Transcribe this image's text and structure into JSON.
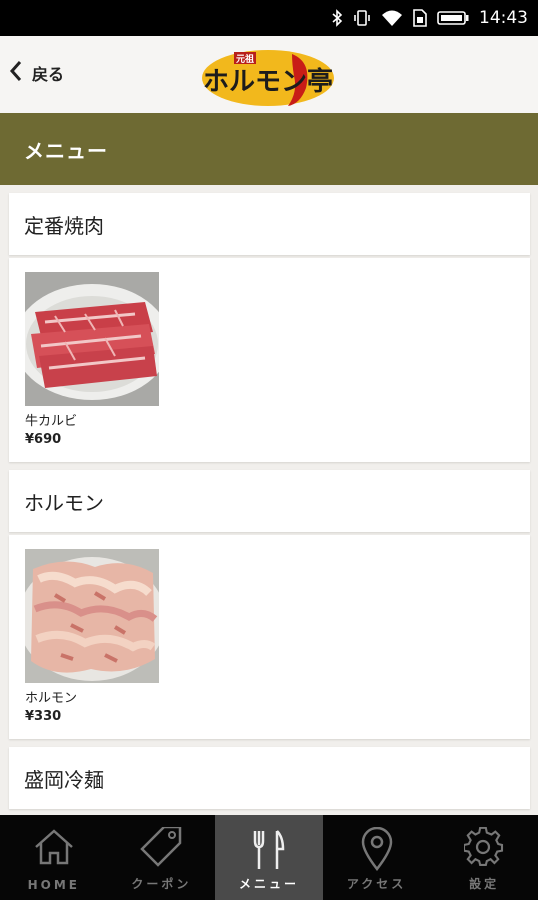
{
  "status_bar": {
    "time": "14:43"
  },
  "header": {
    "back_label": "戻る",
    "logo_text": "ホルモン亭",
    "logo_small_text": "元祖"
  },
  "title_bar": {
    "title": "メニュー"
  },
  "categories": [
    {
      "name": "定番焼肉",
      "items": [
        {
          "name": "牛カルビ",
          "price": "¥690"
        }
      ]
    },
    {
      "name": "ホルモン",
      "items": [
        {
          "name": "ホルモン",
          "price": "¥330"
        }
      ]
    },
    {
      "name": "盛岡冷麺",
      "items": []
    }
  ],
  "tabs": [
    {
      "label": "HOME",
      "icon": "home-icon",
      "active": false
    },
    {
      "label": "クーポン",
      "icon": "coupon-tag-icon",
      "active": false
    },
    {
      "label": "メニュー",
      "icon": "fork-knife-icon",
      "active": true
    },
    {
      "label": "アクセス",
      "icon": "location-pin-icon",
      "active": false
    },
    {
      "label": "設定",
      "icon": "gear-icon",
      "active": false
    }
  ],
  "colors": {
    "title_bar": "#6e6a33",
    "tab_bar": "#060606",
    "tab_active": "#4a4a4a",
    "logo_bg": "#f2b81c"
  }
}
